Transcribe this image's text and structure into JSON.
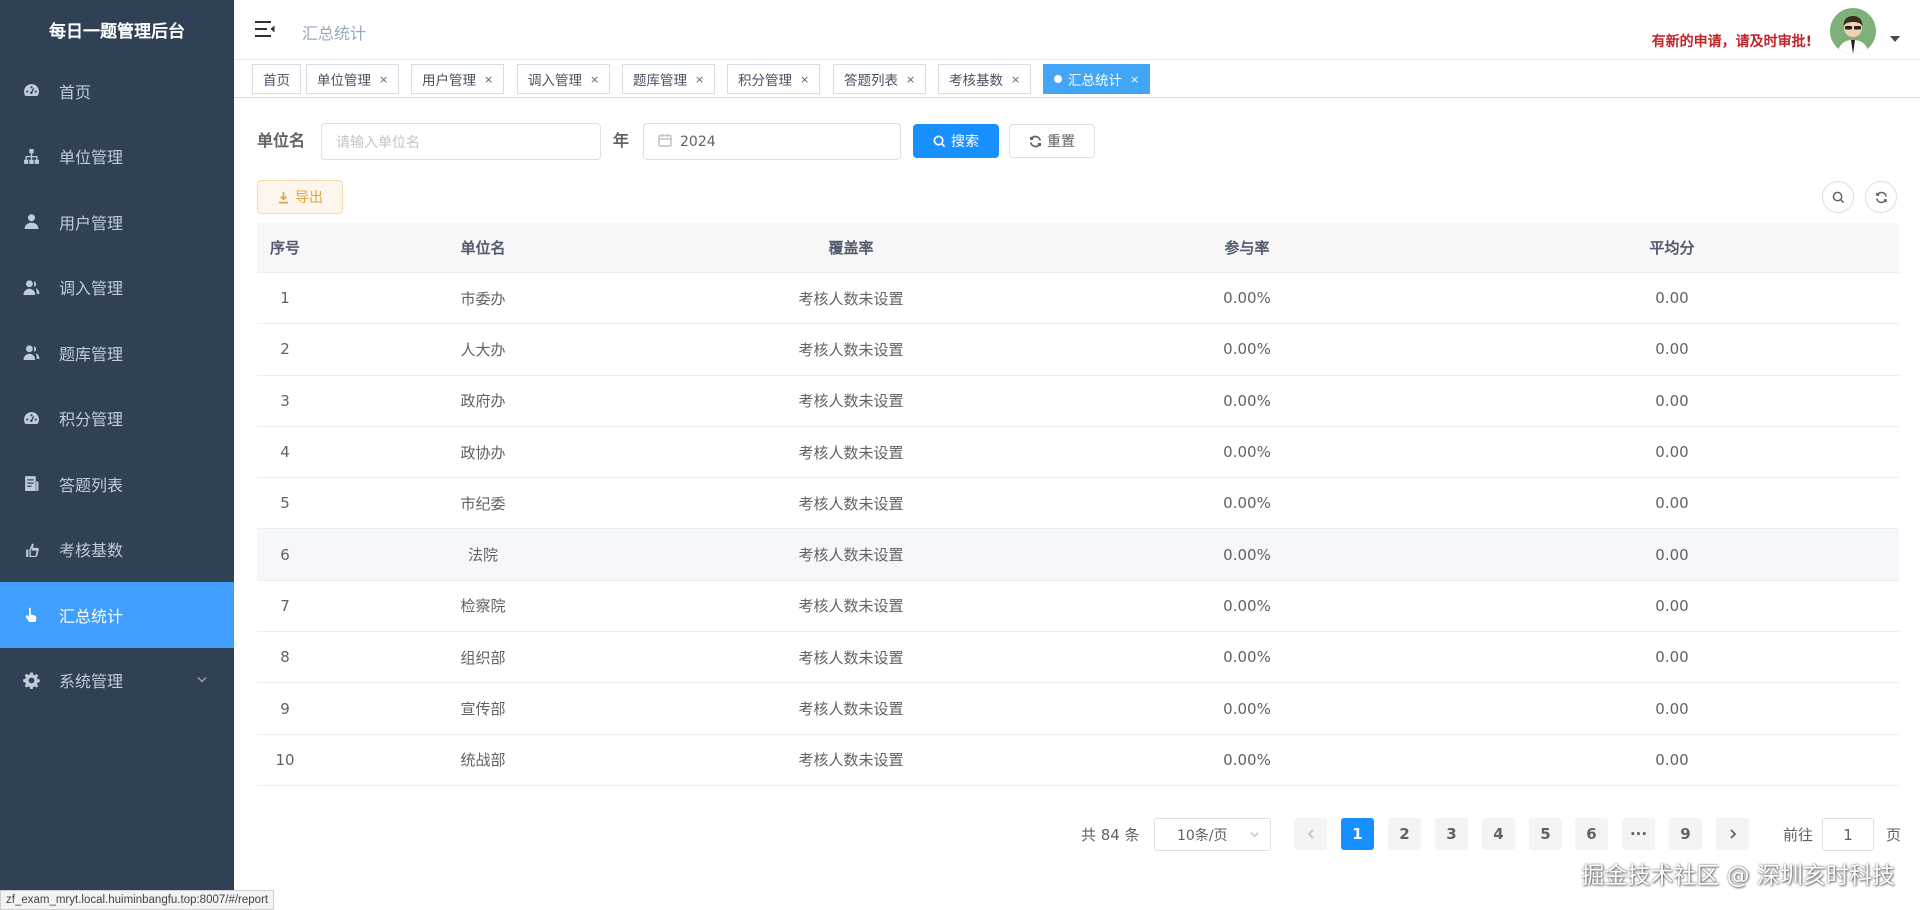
{
  "sidebar": {
    "title": "每日一题管理后台",
    "items": [
      {
        "label": "首页",
        "icon": "dashboard-icon"
      },
      {
        "label": "单位管理",
        "icon": "tree-icon"
      },
      {
        "label": "用户管理",
        "icon": "user-icon"
      },
      {
        "label": "调入管理",
        "icon": "peoples-icon"
      },
      {
        "label": "题库管理",
        "icon": "peoples-icon"
      },
      {
        "label": "积分管理",
        "icon": "dashboard-icon"
      },
      {
        "label": "答题列表",
        "icon": "list-icon"
      },
      {
        "label": "考核基数",
        "icon": "hand-icon"
      },
      {
        "label": "汇总统计",
        "icon": "finger-icon"
      },
      {
        "label": "系统管理",
        "icon": "gear-icon"
      }
    ]
  },
  "header": {
    "breadcrumb": "汇总统计",
    "notice": "有新的申请，请及时审批!"
  },
  "tags": [
    {
      "label": "首页"
    },
    {
      "label": "单位管理"
    },
    {
      "label": "用户管理"
    },
    {
      "label": "调入管理"
    },
    {
      "label": "题库管理"
    },
    {
      "label": "积分管理"
    },
    {
      "label": "答题列表"
    },
    {
      "label": "考核基数"
    },
    {
      "label": "汇总统计"
    }
  ],
  "search": {
    "unit_label": "单位名",
    "unit_placeholder": "请输入单位名",
    "year_label": "年",
    "year_value": "2024",
    "search_button": "搜索",
    "reset_button": "重置",
    "export_button": "导出"
  },
  "table": {
    "headers": [
      "序号",
      "单位名",
      "覆盖率",
      "参与率",
      "平均分"
    ],
    "rows": [
      [
        "1",
        "市委办",
        "考核人数未设置",
        "0.00%",
        "0.00"
      ],
      [
        "2",
        "人大办",
        "考核人数未设置",
        "0.00%",
        "0.00"
      ],
      [
        "3",
        "政府办",
        "考核人数未设置",
        "0.00%",
        "0.00"
      ],
      [
        "4",
        "政协办",
        "考核人数未设置",
        "0.00%",
        "0.00"
      ],
      [
        "5",
        "市纪委",
        "考核人数未设置",
        "0.00%",
        "0.00"
      ],
      [
        "6",
        "法院",
        "考核人数未设置",
        "0.00%",
        "0.00"
      ],
      [
        "7",
        "检察院",
        "考核人数未设置",
        "0.00%",
        "0.00"
      ],
      [
        "8",
        "组织部",
        "考核人数未设置",
        "0.00%",
        "0.00"
      ],
      [
        "9",
        "宣传部",
        "考核人数未设置",
        "0.00%",
        "0.00"
      ],
      [
        "10",
        "统战部",
        "考核人数未设置",
        "0.00%",
        "0.00"
      ]
    ]
  },
  "pagination": {
    "total": "共 84 条",
    "page_size": "10条/页",
    "pages": [
      "1",
      "2",
      "3",
      "4",
      "5",
      "6",
      "···",
      "9"
    ],
    "current": "1",
    "goto_label": "前往",
    "goto_value": "1",
    "page_suffix": "页"
  },
  "status_url": "zf_exam_mryt.local.huiminbangfu.top:8007/#/report",
  "watermark": "掘金技术社区 @ 深圳亥时科技"
}
